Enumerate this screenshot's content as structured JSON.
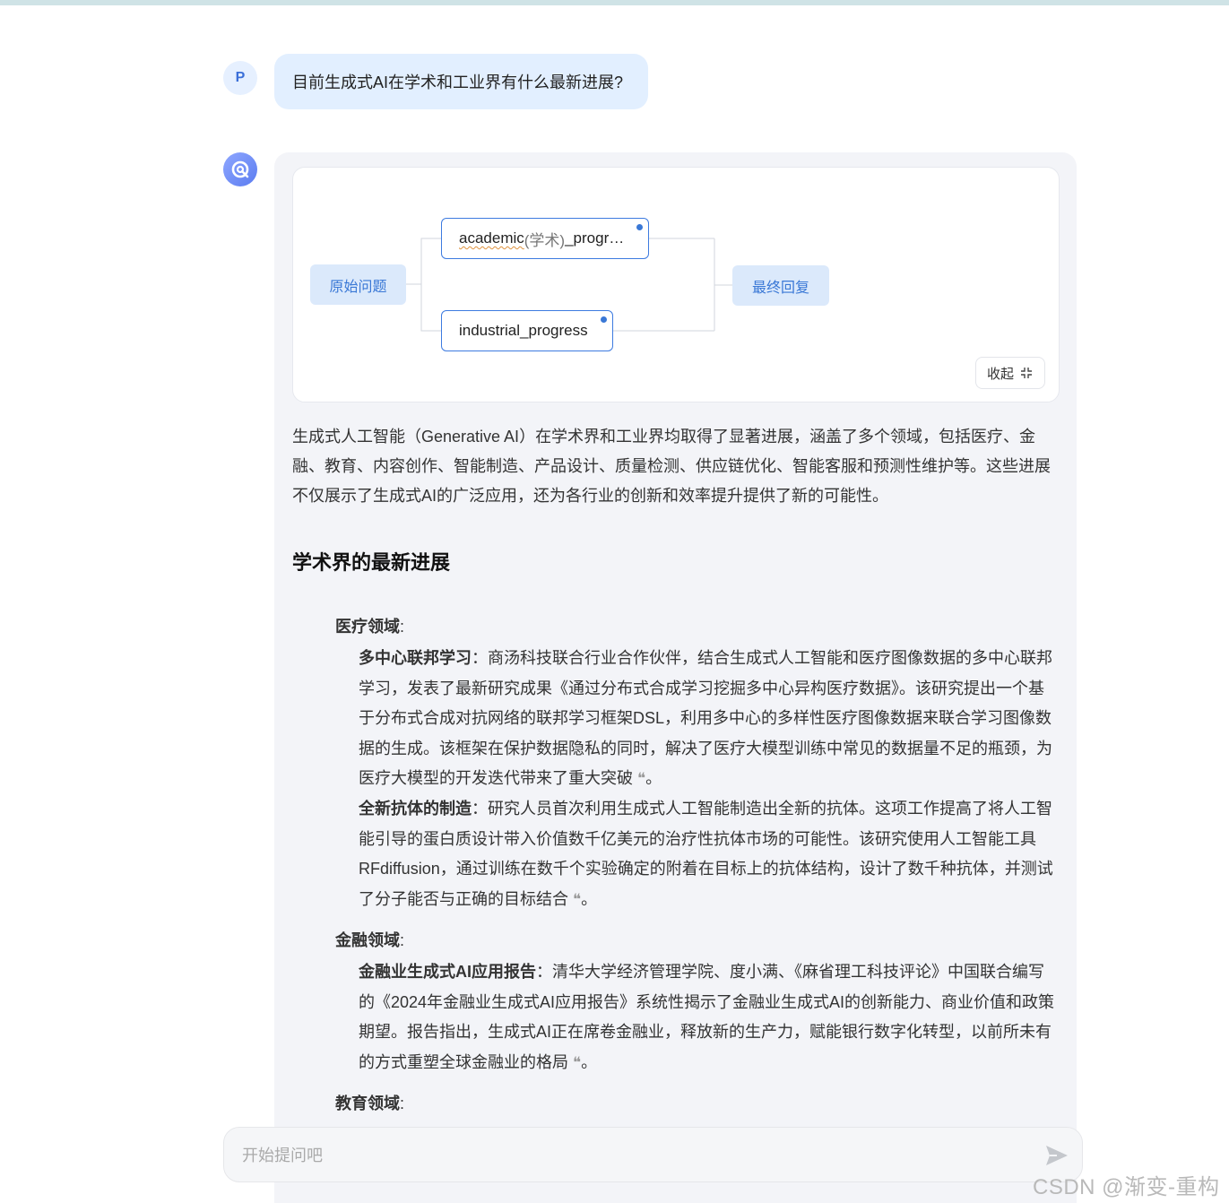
{
  "user": {
    "avatar_letter": "P",
    "question": "目前生成式AI在学术和工业界有什么最新进展?"
  },
  "flow": {
    "start_label": "原始问题",
    "branch1_word": "academic",
    "branch1_cn": "(学术)",
    "branch1_rest": "_progr…",
    "branch2": "industrial_progress",
    "end_label": "最终回复",
    "collapse_label": "收起"
  },
  "answer": {
    "intro": "生成式人工智能（Generative AI）在学术界和工业界均取得了显著进展，涵盖了多个领域，包括医疗、金融、教育、内容创作、智能制造、产品设计、质量检测、供应链优化、智能客服和预测性维护等。这些进展不仅展示了生成式AI的广泛应用，还为各行业的创新和效率提升提供了新的可能性。",
    "heading": "学术界的最新进展",
    "sections": [
      {
        "title": "医疗领域",
        "items": [
          {
            "title": "多中心联邦学习",
            "text": "商汤科技联合行业合作伙伴，结合生成式人工智能和医疗图像数据的多中心联邦学习，发表了最新研究成果《通过分布式合成学习挖掘多中心异构医疗数据》。该研究提出一个基于分布式合成对抗网络的联邦学习框架DSL，利用多中心的多样性医疗图像数据来联合学习图像数据的生成。该框架在保护数据隐私的同时，解决了医疗大模型训练中常见的数据量不足的瓶颈，为医疗大模型的开发迭代带来了重大突破"
          },
          {
            "title": "全新抗体的制造",
            "text": "研究人员首次利用生成式人工智能制造出全新的抗体。这项工作提高了将人工智能引导的蛋白质设计带入价值数千亿美元的治疗性抗体市场的可能性。该研究使用人工智能工具RFdiffusion，通过训练在数千个实验确定的附着在目标上的抗体结构，设计了数千种抗体，并测试了分子能否与正确的目标结合"
          }
        ]
      },
      {
        "title": "金融领域",
        "items": [
          {
            "title": "金融业生成式AI应用报告",
            "text": "清华大学经济管理学院、度小满、《麻省理工科技评论》中国联合编写的《2024年金融业生成式AI应用报告》系统性揭示了金融业生成式AI的创新能力、商业价值和政策期望。报告指出，生成式AI正在席卷金融业，释放新的生产力，赋能银行数字化转型，以前所未有的方式重塑全球金融业的格局"
          }
        ]
      },
      {
        "title": "教育领域",
        "items": []
      }
    ],
    "sep": "：",
    "period": "。",
    "cite_glyph": "❝",
    "colon_ascii": ":"
  },
  "input": {
    "placeholder": "开始提问吧"
  },
  "watermark": "CSDN @渐变-重构",
  "colors": {
    "accent": "#3a78d6",
    "user_bubble": "#e2efff",
    "panel_bg": "#f3f4f8"
  }
}
